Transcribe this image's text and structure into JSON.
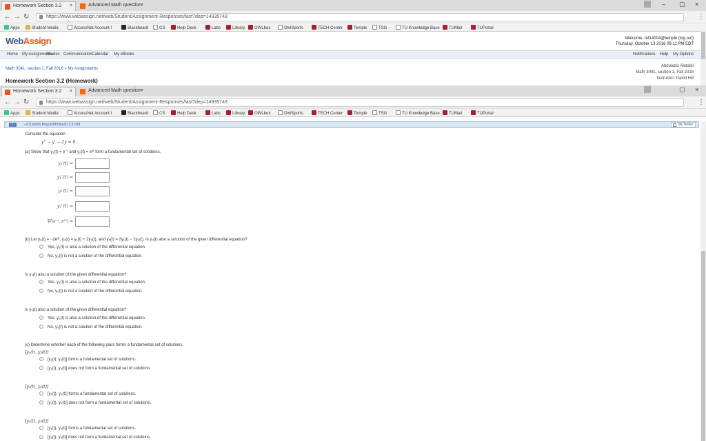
{
  "browser": {
    "tabs": [
      {
        "label": "Homework Section 3.2"
      },
      {
        "label": "Advanced Math question"
      }
    ],
    "url": "https://www.webassign.net/web/Student/Assignment-Responses/last?dep=14935743",
    "bookmarks": [
      "Apps",
      "Student Media",
      "AccessNet Account I",
      "Blackboard",
      "CS",
      "Help Desk",
      "Labs",
      "Library",
      "OWLbox",
      "OwlSports",
      "TECH Center",
      "Temple",
      "TSG",
      "TU Knowledge Base",
      "TUMail",
      "TUPortal"
    ]
  },
  "site": {
    "logo_a": "Web",
    "logo_b": "Assign",
    "welcome_line1": "Welcome, tuf14004@temple (log out)",
    "welcome_line2": "Thursday, October 13 2016 09:11 PM EDT",
    "menu": [
      "Home",
      "My Assignments",
      "Grades",
      "Communication",
      "Calendar",
      "My eBooks"
    ],
    "menu_right": [
      "Notifications",
      "Help",
      "My Options"
    ],
    "breadcrumb": "Math 3041, section 1, Fall 2016",
    "breadcrumb_sep": " » ",
    "breadcrumb_tail": "My Assignments",
    "homework_title": "Homework Section 3.2 (Homework)",
    "course_info": [
      "Abdulaziz Alotaibi",
      "Math 3041, section 1, Fall 2016",
      "Instructor: David Hill"
    ]
  },
  "question": {
    "number": "7.",
    "points": "–/15 points  BoyceDiPrima10 3.2.028",
    "my_notes": "My Notes",
    "intro": "Consider the equation",
    "equation": "y'' − y' − 2y = 0.",
    "part_a": "(a) Show that  y₁(t) = e⁻ᵗ  and  y₂(t) = e²ᵗ  form a fundamental set of solutions.",
    "inputs": [
      "y₁'(t) =",
      "y₁''(t) =",
      "y₂'(t) =",
      "y₂''(t) =",
      "W(e⁻ᵗ, e²ᵗ) ="
    ],
    "part_b": "(b) Let  y₃(t) = −2e²ᵗ,  y₄(t) = y₁(t) + 2y₂(t),  and  y₅(t) = 2y₁(t) − 2y₃(t).  Is  y₃(t)  also a solution of the given differential equation?",
    "b1_options": [
      "Yes, y₃(t) is also a solution of the differential equation.",
      "No, y₃(t) is not a solution of the differential equation."
    ],
    "q_y4": "Is  y₄(t)  also a solution of the given differential equation?",
    "b2_options": [
      "Yes, y₄(t) is also a solution of the differential equation.",
      "No, y₄(t) is not a solution of the differential equation."
    ],
    "q_y5": "Is  y₅(t)  also a solution of the given differential equation?",
    "b3_options": [
      "Yes, y₅(t) is also a solution of the differential equation.",
      "No, y₅(t) is not a solution of the differential equation."
    ],
    "part_c": "(c) Determine whether each of the following pairs forms a fundamental set of solutions.",
    "pairs": [
      {
        "label": "[y₁(t), y₃(t)]",
        "options": [
          "[y₁(t), y₃(t)] forms a fundamental set of solutions.",
          "[y₁(t), y₃(t)] does not form a fundamental set of solutions."
        ]
      },
      {
        "label": "[y₂(t), y₃(t)]",
        "options": [
          "[y₂(t), y₃(t)] forms a fundamental set of solutions.",
          "[y₂(t), y₃(t)] does not form a fundamental set of solutions."
        ]
      },
      {
        "label": "[y₁(t), y₄(t)]",
        "options": [
          "[y₁(t), y₄(t)] forms a fundamental set of solutions.",
          "[y₁(t), y₄(t)] does not form a fundamental set of solutions."
        ]
      }
    ]
  },
  "colors": {
    "accent": "#3d5a80",
    "brand_orange": "#e9541c",
    "temple_red": "#a31f34",
    "link": "#2a5aa8"
  }
}
